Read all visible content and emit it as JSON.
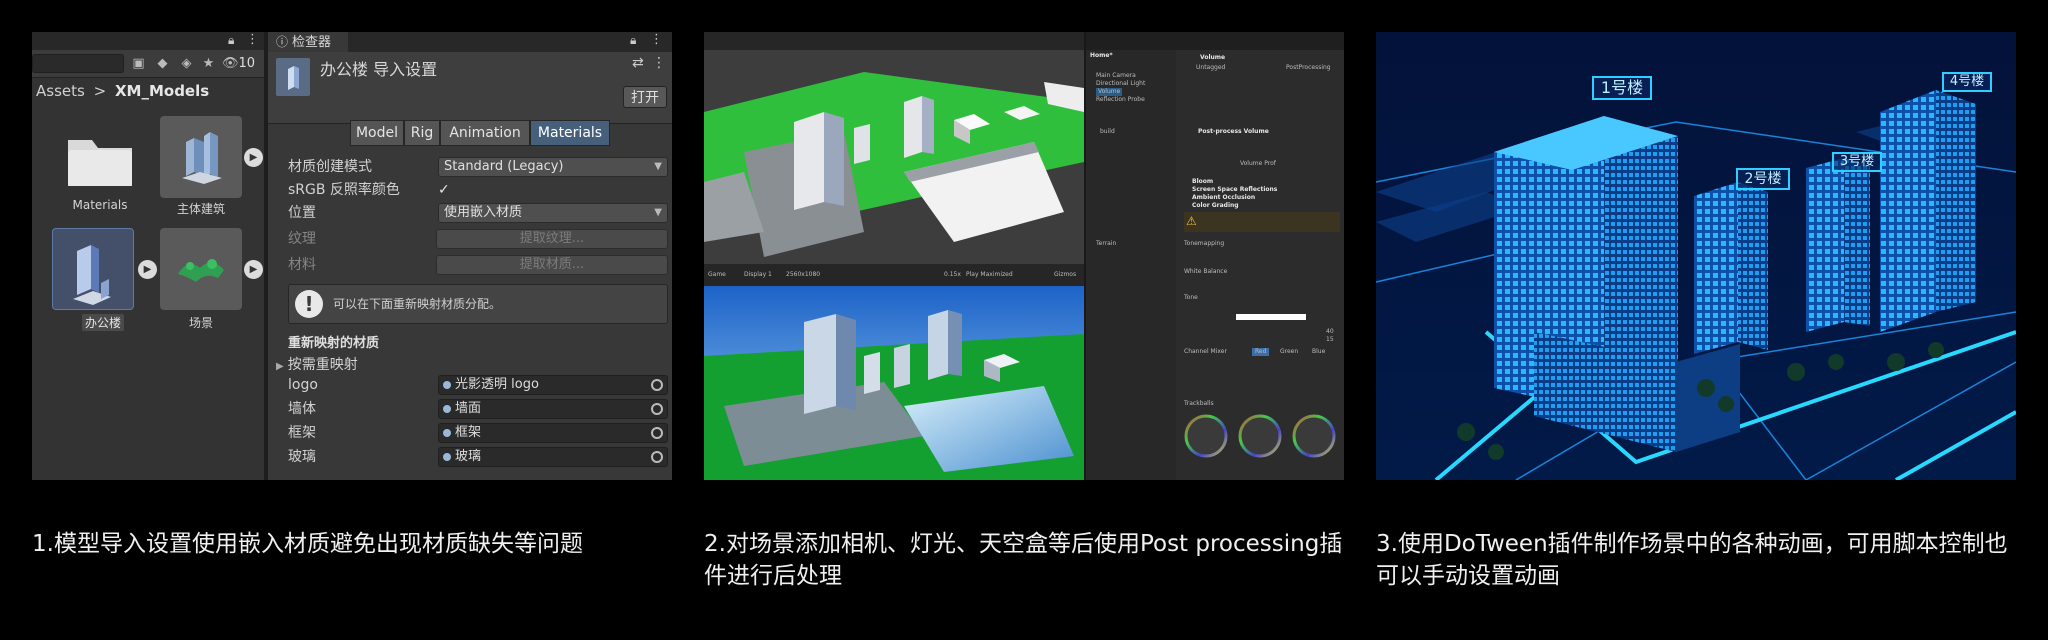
{
  "panel1": {
    "project": {
      "toolbar_count": "10",
      "breadcrumb_root": "Assets",
      "breadcrumb_sep": ">",
      "breadcrumb_current": "XM_Models",
      "assets": [
        {
          "label": "Materials"
        },
        {
          "label": "主体建筑"
        },
        {
          "label": "办公楼"
        },
        {
          "label": "场景"
        }
      ]
    },
    "inspector": {
      "tab_label": "检查器",
      "title": "办公楼 导入设置",
      "open_button": "打开",
      "tabs": [
        {
          "label": "Model"
        },
        {
          "label": "Rig"
        },
        {
          "label": "Animation"
        },
        {
          "label": "Materials"
        }
      ],
      "fields": {
        "material_creation_mode": {
          "label": "材质创建模式",
          "value": "Standard (Legacy)"
        },
        "srgb": {
          "label": "sRGB 反照率颜色",
          "check": "✓"
        },
        "location": {
          "label": "位置",
          "value": "使用嵌入材质"
        },
        "textures": {
          "label": "纹理",
          "button": "提取纹理..."
        },
        "materials": {
          "label": "材料",
          "button": "提取材质..."
        }
      },
      "help_text": "可以在下面重新映射材质分配。",
      "remapped_header": "重新映射的材质",
      "remap_by_name": "按需重映射",
      "remap_rows": [
        {
          "key": "logo",
          "value": "光影透明 logo"
        },
        {
          "key": "墙体",
          "value": "墙面"
        },
        {
          "key": "框架",
          "value": "框架"
        },
        {
          "key": "玻璃",
          "value": "玻璃"
        }
      ]
    }
  },
  "panel2": {
    "game_toolbar": {
      "tab": "Game",
      "display": "Display 1",
      "resolution": "2560x1080",
      "zoom": "0.15x",
      "maximized": "Play Maximized",
      "gizmos": "Gizmos"
    },
    "hierarchy": [
      "Home*",
      "Main Camera",
      "Directional Light",
      "Volume",
      "Reflection Probe",
      "build",
      "Terrain"
    ],
    "inspector": {
      "object": "Volume",
      "tag": "Untagged",
      "layer": "PostProcessing",
      "component": "Post-process Volume",
      "profile": "Volume Prof",
      "effects": [
        "Bloom",
        "Screen Space Reflections",
        "Ambient Occlusion",
        "Color Grading"
      ],
      "grading_labels": [
        "Tonemapping",
        "White Balance",
        "Tone",
        "Channel Mixer",
        "Trackballs"
      ],
      "saturation": "40",
      "contrast": "15",
      "mixer_tabs": [
        "Red",
        "Green",
        "Blue"
      ]
    }
  },
  "panel3": {
    "labels": [
      "1号楼",
      "2号楼",
      "3号楼",
      "4号楼"
    ]
  },
  "captions": [
    "1.模型导入设置使用嵌入材质避免出现材质缺失等问题",
    "2.对场景添加相机、灯光、天空盒等后使用Post processing插件进行后处理",
    "3.使用DoTween插件制作场景中的各种动画，可用脚本控制也可以手动设置动画"
  ]
}
